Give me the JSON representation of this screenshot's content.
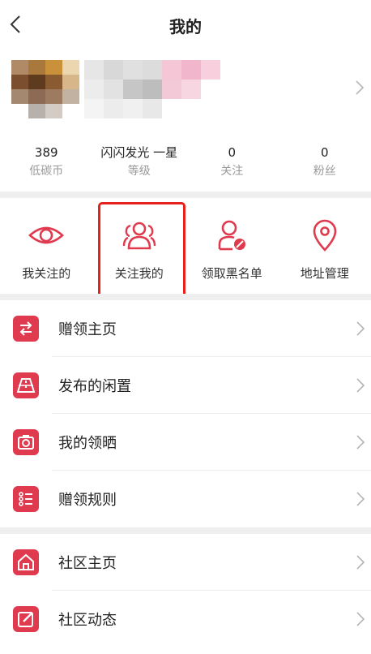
{
  "header": {
    "title": "我的"
  },
  "profile": {
    "avatar_colors": [
      "#b08a66",
      "#a8783c",
      "#c9913a",
      "#ecd6b0",
      "#7a4e2e",
      "#5e3a1e",
      "#8a5a30",
      "#d7b78a",
      "#a58870",
      "#8c6a56",
      "#9e7a60",
      "#c2b2a2",
      "#ffffff",
      "#b8b0aa",
      "#d4ccc4",
      "#ffffff"
    ],
    "nickname_colors": [
      "#e6e6e6",
      "#d8d8d8",
      "#e0e0e0",
      "#dcdcdc",
      "#f5c6d6",
      "#f2b6cc",
      "#f7cfdd",
      "#ececec",
      "#e2e2e2",
      "#c6c6c6",
      "#bdbdbd",
      "#f3c9d8",
      "#f7d6e2",
      "#ffffff",
      "#f4f4f4",
      "#ececec",
      "#f0f0f0",
      "#e8e8e8",
      "#ffffff",
      "#ffffff",
      "#ffffff"
    ]
  },
  "stats": [
    {
      "value": "389",
      "label": "低碳币"
    },
    {
      "value": "闪闪发光 一星",
      "label": "等级"
    },
    {
      "value": "0",
      "label": "关注"
    },
    {
      "value": "0",
      "label": "粉丝"
    }
  ],
  "quick_actions": [
    {
      "label": "我关注的",
      "icon": "eye-icon"
    },
    {
      "label": "关注我的",
      "icon": "users-icon"
    },
    {
      "label": "领取黑名单",
      "icon": "user-blocked-icon"
    },
    {
      "label": "地址管理",
      "icon": "location-pin-icon"
    }
  ],
  "menu_group_1": [
    {
      "label": "赠领主页",
      "icon": "swap-arrows-icon"
    },
    {
      "label": "发布的闲置",
      "icon": "road-icon"
    },
    {
      "label": "我的领晒",
      "icon": "camera-icon"
    },
    {
      "label": "赠领规则",
      "icon": "list-icon"
    }
  ],
  "menu_group_2": [
    {
      "label": "社区主页",
      "icon": "home-icon"
    },
    {
      "label": "社区动态",
      "icon": "edit-icon"
    }
  ],
  "colors": {
    "accent": "#e03a4e",
    "highlight_border": "#e8201b",
    "separator": "#efefef"
  }
}
